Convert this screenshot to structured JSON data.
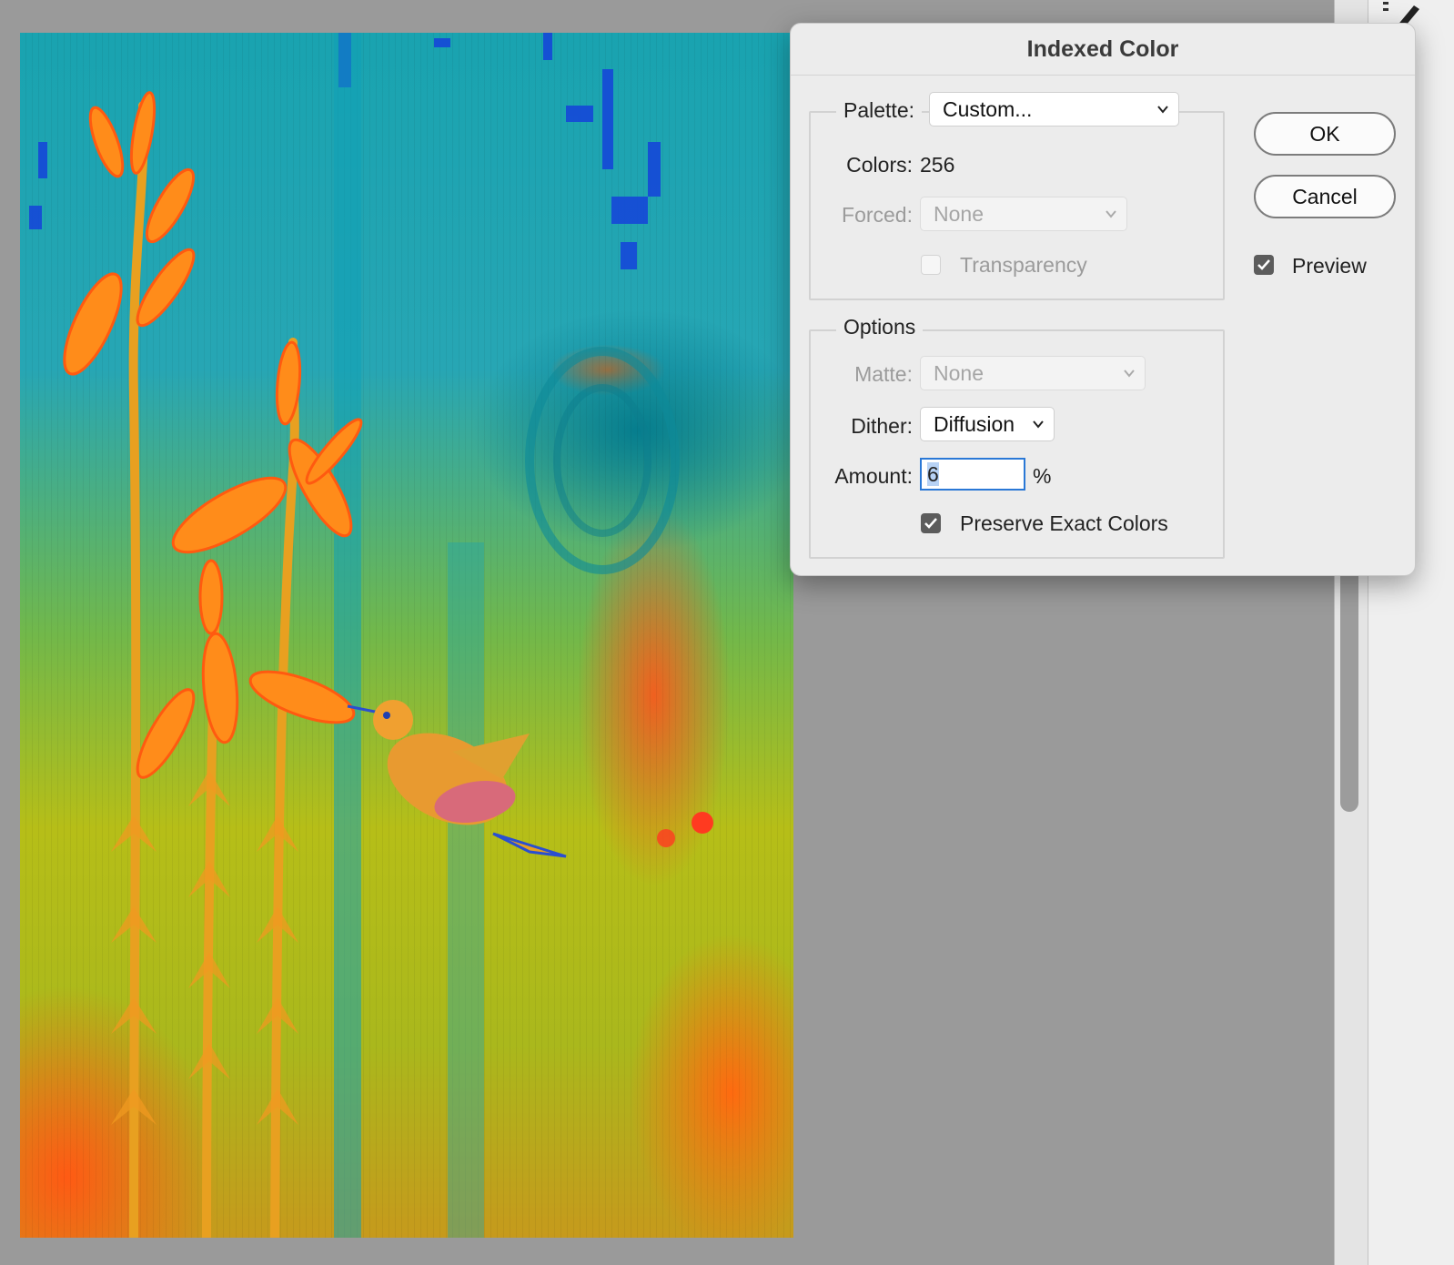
{
  "dialog": {
    "title": "Indexed Color",
    "palette_label": "Palette:",
    "palette_value": "Custom...",
    "colors_label": "Colors:",
    "colors_value": "256",
    "forced_label": "Forced:",
    "forced_value": "None",
    "transparency_label": "Transparency",
    "transparency_checked": false,
    "options_legend": "Options",
    "matte_label": "Matte:",
    "matte_value": "None",
    "dither_label": "Dither:",
    "dither_value": "Diffusion",
    "amount_label": "Amount:",
    "amount_value": "6",
    "amount_unit": "%",
    "preserve_label": "Preserve Exact Colors",
    "preserve_checked": true,
    "ok_label": "OK",
    "cancel_label": "Cancel",
    "preview_label": "Preview",
    "preview_checked": true
  },
  "colors": {
    "workspace": "#9a9a9a",
    "dialog_bg": "#ececec",
    "focus_blue": "#2a78d6",
    "checkbox_checked": "#5c5c5c"
  },
  "icons": [
    "chevron-down-icon",
    "checkmark-icon",
    "brush-tool-icon"
  ]
}
